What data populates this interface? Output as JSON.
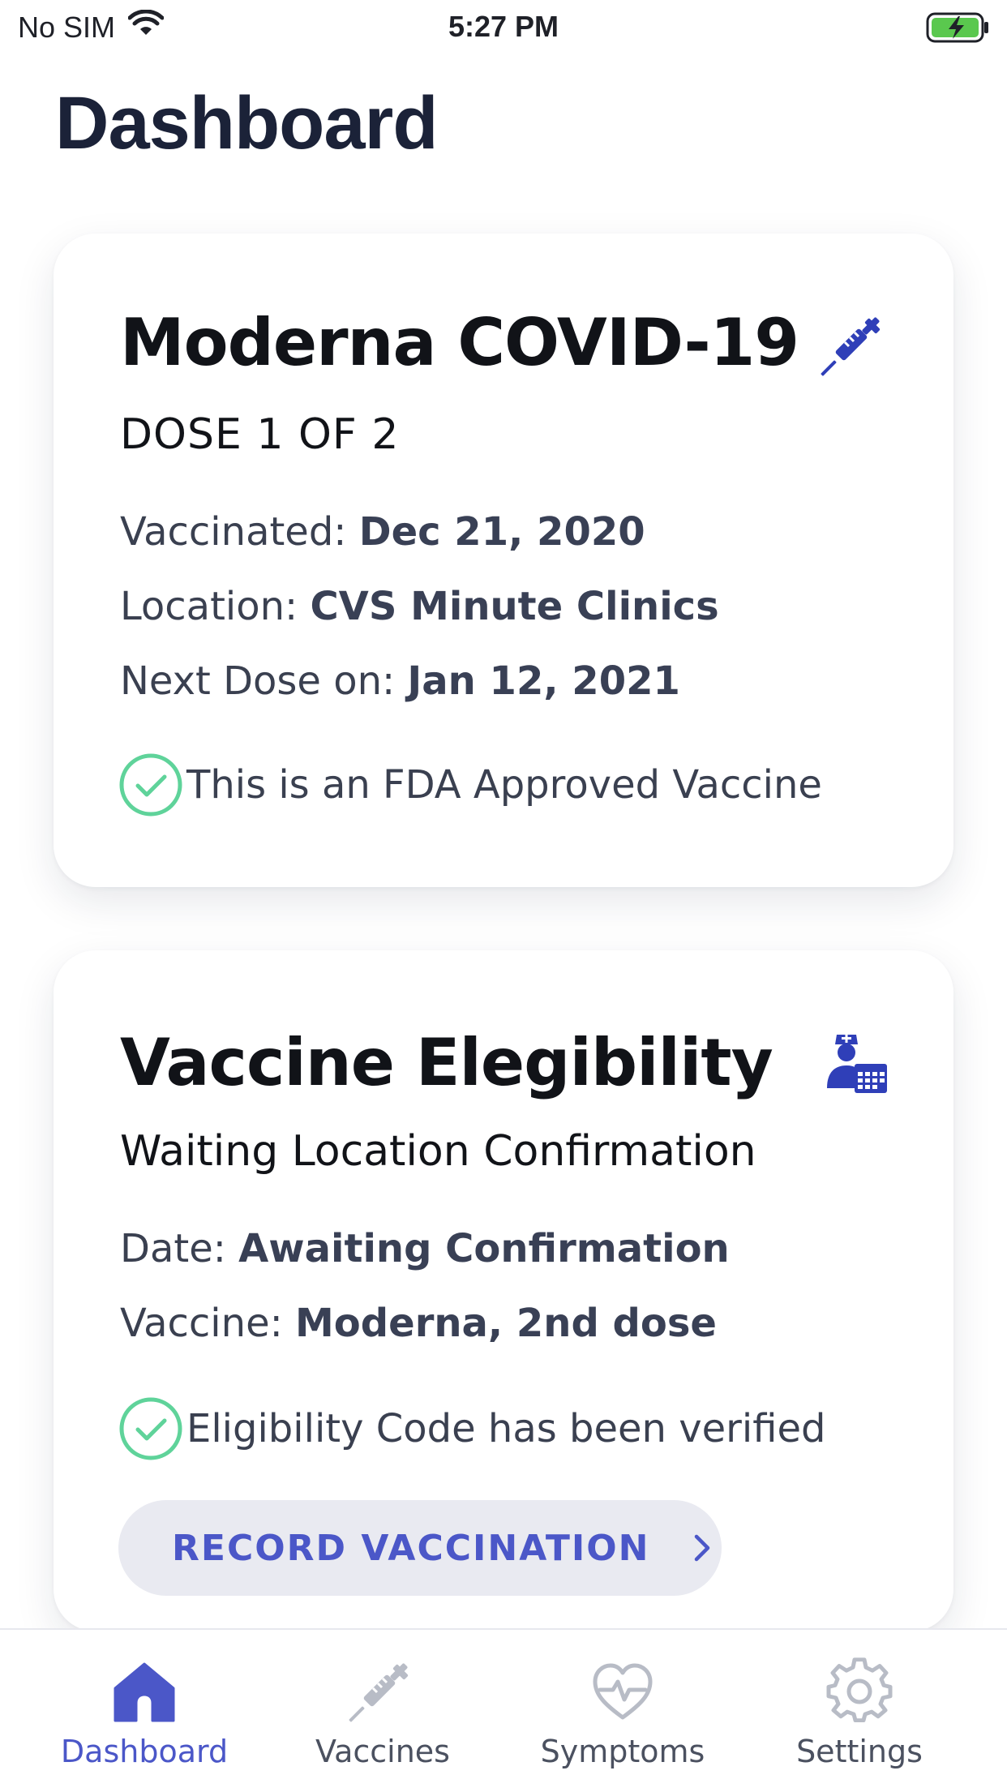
{
  "status_bar": {
    "carrier": "No SIM",
    "time": "5:27 PM"
  },
  "header": {
    "title": "Dashboard"
  },
  "vaccine_card": {
    "title": "Moderna COVID-19",
    "icon": "syringe-icon",
    "subtitle": "DOSE 1 OF 2",
    "vaccinated_label": "Vaccinated: ",
    "vaccinated_value": "Dec 21, 2020",
    "location_label": "Location: ",
    "location_value": "CVS Minute Clinics",
    "next_dose_label": "Next Dose on: ",
    "next_dose_value": "Jan 12, 2021",
    "approval_text": "This is an FDA Approved Vaccine"
  },
  "eligibility_card": {
    "title": "Vaccine Elegibility",
    "icon": "nurse-calendar-icon",
    "subtitle": "Waiting Location Confirmation",
    "date_label": "Date: ",
    "date_value": "Awaiting Confirmation",
    "vaccine_label": "Vaccine: ",
    "vaccine_value": "Moderna, 2nd dose",
    "verified_text": "Eligibility Code has been verified",
    "button_label": "RECORD VACCINATION"
  },
  "tabs": [
    {
      "label": "Dashboard",
      "icon": "home-icon",
      "active": true
    },
    {
      "label": "Vaccines",
      "icon": "syringe-icon",
      "active": false
    },
    {
      "label": "Symptoms",
      "icon": "heart-pulse-icon",
      "active": false
    },
    {
      "label": "Settings",
      "icon": "gear-icon",
      "active": false
    }
  ],
  "colors": {
    "accent": "#4b57c8",
    "icon_blue": "#2f3fb8",
    "check_green": "#5fd39a",
    "title_dark": "#1b2238",
    "battery_green": "#5ac84e"
  }
}
